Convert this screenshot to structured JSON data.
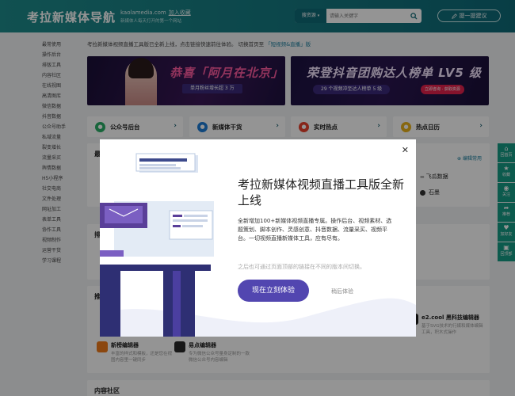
{
  "header": {
    "logo": "考拉新媒体导航",
    "domain": "kaolamedia.com",
    "favorite": "加入收藏",
    "tagline": "新媒体人每天打开的第一个网站",
    "search_type": "搜资源",
    "search_placeholder": "请输入关键字",
    "suggest": "提一提建议"
  },
  "nav": [
    "最常使用",
    "操作后台",
    "排版工具",
    "内容社区",
    "在线视图",
    "高清图库",
    "微信数据",
    "抖音数据",
    "公众号助手",
    "私域流量",
    "裂变增长",
    "流量采买",
    "舆情数据",
    "H5小程序",
    "社交电商",
    "文件处理",
    "网址加工",
    "表单工具",
    "协作工具",
    "视频制作",
    "运营干货",
    "学习课程"
  ],
  "notice": {
    "text": "考拉新媒体视频直播工具版已全新上线，点击链接快速前往体验。 切换首页至",
    "link": "「短视频&直播」版"
  },
  "banners": {
    "b1_title": "恭喜「阿月在北京」",
    "b1_sub": "单月粉丝增长超 3 万",
    "b2_title": "荣登抖音团购达人榜单 LV5 级",
    "b2_sub": "29 个视频冲至达人榜单 5 级",
    "b2_chip": "立即咨询 · 获取资源"
  },
  "cards": [
    {
      "label": "公众号后台",
      "icon": "wechat-icon",
      "color": "#2aae67"
    },
    {
      "label": "新媒体干货",
      "icon": "person-icon",
      "color": "#1e7dd6"
    },
    {
      "label": "实时热点",
      "icon": "fire-icon",
      "color": "#e8412c"
    },
    {
      "label": "热点日历",
      "icon": "calendar-icon",
      "color": "#e8b21a"
    }
  ],
  "panel1": {
    "title": "最",
    "manage": "编辑常用",
    "item1": "飞瓜数据",
    "item2": "石墨"
  },
  "panel2": {
    "title": "排"
  },
  "panel3": {
    "title": "推",
    "e2_name": "e2.cool 黑科技编辑器",
    "e2_desc": "基于SVG技术的行媒和媒体编辑工具，积木式操作",
    "t1_name": "新榜编辑器",
    "t1_desc": "丰富的样式和模板，还是您在视图内容里一键同步",
    "t2_name": "易点编辑器",
    "t2_desc": "专为微信公众号量身定制的一款微信公众号内容编辑"
  },
  "panel4": {
    "title": "内容社区"
  },
  "side": [
    {
      "icon": "arrow-up-icon",
      "label": "回首页"
    },
    {
      "icon": "star-icon",
      "label": "收藏"
    },
    {
      "icon": "eye-icon",
      "label": "关注"
    },
    {
      "icon": "share-icon",
      "label": "推荐"
    },
    {
      "icon": "heart-icon",
      "label": "加好友"
    },
    {
      "icon": "app-icon",
      "label": "回顶部"
    }
  ],
  "modal": {
    "title": "考拉新媒体视频直播工具版全新上线",
    "desc": "全新增加100+新媒体视频直播专属。操作后台、视频素材、选题策划、脚本创作、灵感创意、抖音数据、流量采买、视频平台。一切视频直播新媒体工具，应有尽有。",
    "note": "之后也可通过页面顶部的链接在不同的版本间切换。",
    "primary": "现在立刻体验",
    "later": "稍后体验",
    "accent": "#5246b0"
  }
}
